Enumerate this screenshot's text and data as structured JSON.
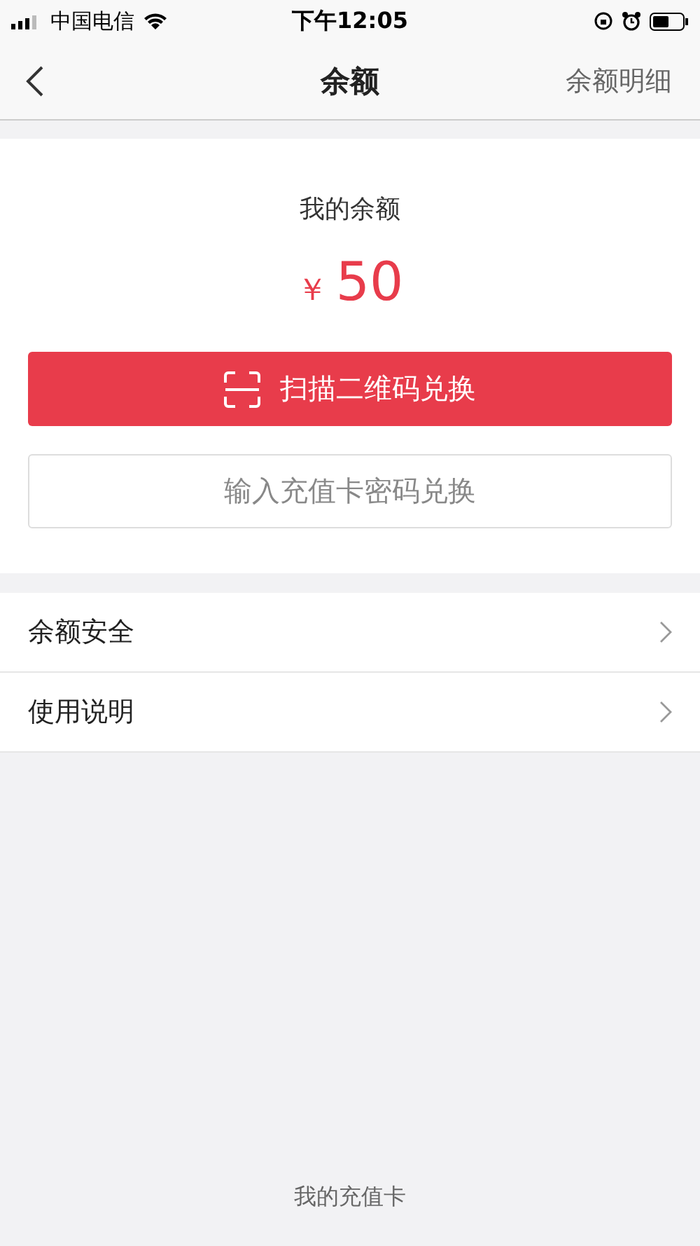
{
  "status_bar": {
    "carrier": "中国电信",
    "time": "下午12:05"
  },
  "nav": {
    "title": "余额",
    "action": "余额明细"
  },
  "balance": {
    "label": "我的余额",
    "currency": "￥",
    "amount": "50"
  },
  "buttons": [
    {
      "kind": "primary",
      "label": "扫描二维码兑换"
    },
    {
      "kind": "outline",
      "label": "输入充值卡密码兑换"
    }
  ],
  "menu": [
    {
      "label": "余额安全"
    },
    {
      "label": "使用说明"
    }
  ],
  "footer_link": "我的充值卡"
}
